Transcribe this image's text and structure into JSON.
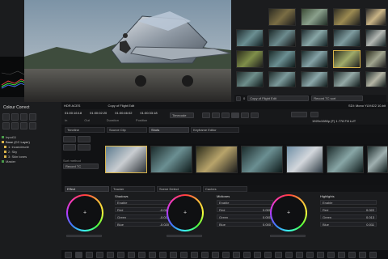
{
  "left_panel": {
    "title": "Colour Correct",
    "tree": [
      "Input11",
      "Base (CC Layer)",
      "1: Incandescte",
      "2: Sky",
      "3: Skin tones",
      "Master"
    ]
  },
  "viewer_bar": {
    "left_label": "HDR ACES",
    "title": "Copy of Flight Edit",
    "right_label": "SDI: Mono YUV422 10-bit"
  },
  "timecodes": {
    "a": "01:00:16:18",
    "b": "01:00:02:20",
    "c": "01:00:46:02",
    "d": "01:00:33:18",
    "labels": {
      "in": "In",
      "out": "Out",
      "dur": "Duration",
      "pos": "Position"
    },
    "mode": "Timecode",
    "format": "1920x1080p (F) 1.778 Fill LUT"
  },
  "right_top": {
    "toolbar_value": "0",
    "dropdown": "Copy of Flight Edit",
    "sort": "Record TC sort"
  },
  "tabs": {
    "timeline": "Timeline",
    "source_clip": "Source Clip",
    "shots": "Shots",
    "keyframe": "Keyframe Editor"
  },
  "sort_method": {
    "label": "Sort method",
    "value": "Record TC"
  },
  "bottom_tabs": {
    "effect": "Effect",
    "tracker": "Tracker",
    "scene_detect": "Scene Detect",
    "caches": "Caches"
  },
  "grading": {
    "sections": [
      {
        "name": "Shadows",
        "enable": "Enable",
        "red": "-0.017",
        "green": "-0.013",
        "blue": "-0.020"
      },
      {
        "name": "Midtones",
        "enable": "Enable",
        "red": "0.000",
        "green": "0.000",
        "blue": "0.000"
      },
      {
        "name": "Highlights",
        "enable": "Enable",
        "red": "0.022",
        "green": "0.013",
        "blue": "0.011"
      }
    ],
    "labels": {
      "red": "Red",
      "green": "Green",
      "blue": "Blue"
    },
    "colors": {
      "red": "#d04040",
      "green": "#40b040",
      "blue": "#4060d0"
    }
  },
  "accent": "#d6b24a"
}
